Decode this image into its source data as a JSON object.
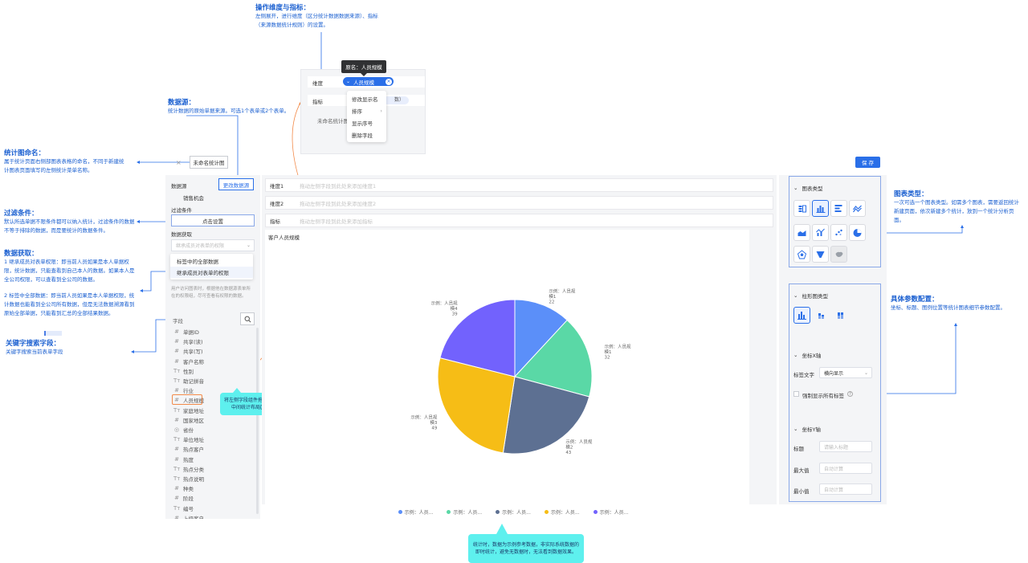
{
  "annotations": {
    "dimension_metric": {
      "title": "操作维度与指标：",
      "body": [
        "左侧展开，进行维度（区分统计数据数据来源）、指标",
        "（来源数据统计规则）的设置。"
      ]
    },
    "datasource": {
      "title": "数据源：",
      "body": [
        "统计数据的原始单据来源。可选1个表单或2个表单。"
      ]
    },
    "chart_name": {
      "title": "统计图命名：",
      "body": [
        "属于统计页面右侧部图表表格的命名，不同于新建统",
        "计图表页面填写的左侧统计菜单名称。"
      ]
    },
    "filter": {
      "title": "过滤条件：",
      "body": [
        "默认所选单据不限条件都可以纳入统计，过滤条件的数据",
        "不等于排除的数据，而是要统计的数据条件。"
      ]
    },
    "data_fetch": {
      "title": "数据获取：",
      "body": [
        "1 继承成员对表单权限：即当前人员如果是本人单据权",
        "限，统计数据，只能查看到自己本人的数据。如果本人是",
        "全公司权限，可以查看到全公司的数据。",
        "",
        "2 标签中全部数据：即当前人员如果是本人单据权限，统",
        "计数据也能看到全公司所有数据，但是无法数据溯源看到",
        "原始全部单据，只能看到汇总的全部结果数据。"
      ]
    },
    "keyword_search": {
      "title": "关键字搜索字段：",
      "body": [
        "关键字搜索当前表单字段"
      ]
    },
    "chart_type": {
      "title": "图表类型：",
      "body": [
        "一次可选一个图表类型。如需多个图表，需要返回统计",
        "新建页面，依次新建多个统计，放到一个统计分析页",
        "面。"
      ]
    },
    "params": {
      "title": "具体参数配置：",
      "body": [
        "坐标、标题、图例位置等统计图表细节参数配置。"
      ]
    },
    "drag_tip": [
      "将左侧字段组件拖拽到",
      "中间统计布局区"
    ],
    "sample_tip": [
      "统计时，数据为示例参考数据，非实际系统数据的",
      "即时统计，避免无数据时，无法看到数据效果。"
    ]
  },
  "popup": {
    "tooltip": "原名：人员规模",
    "dim_label": "维度",
    "metric_label": "指标",
    "chip": "人员规模",
    "metric_chip": "数）",
    "unnamed": "未命名统计图",
    "menu": [
      "修改显示名",
      "排序",
      "显示序号",
      "删除字段"
    ]
  },
  "header": {
    "chart_name": "未命名统计图",
    "save": "保 存"
  },
  "left": {
    "datasource_label": "数据源",
    "change_datasource": "更改数据源",
    "datasource_value": "销售机会",
    "filter_label": "过滤条件",
    "filter_button": "点击设置",
    "fetch_label": "数据获取",
    "fetch_placeholder": "继承成员对表单的权限",
    "fetch_options": [
      "标签中的全部数据",
      "继承成员对表单的权限"
    ],
    "fetch_help": [
      "用户访问图表时，根据他在数据源表单所",
      "在的权限组，尽可查看有权限的数据。"
    ],
    "fields_label": "字段",
    "fields": [
      {
        "icon": "#",
        "name": "单据ID"
      },
      {
        "icon": "#",
        "name": "共享(读)"
      },
      {
        "icon": "#",
        "name": "共享(写)"
      },
      {
        "icon": "#",
        "name": "客户名称"
      },
      {
        "icon": "Tт",
        "name": "性别"
      },
      {
        "icon": "Tт",
        "name": "助记拼音"
      },
      {
        "icon": "#",
        "name": "行业"
      },
      {
        "icon": "#",
        "name": "人员规模"
      },
      {
        "icon": "Tт",
        "name": "家庭地址"
      },
      {
        "icon": "#",
        "name": "国家地区"
      },
      {
        "icon": "◎",
        "name": "省份"
      },
      {
        "icon": "Tт",
        "name": "单位地址"
      },
      {
        "icon": "#",
        "name": "热点客户"
      },
      {
        "icon": "#",
        "name": "热度"
      },
      {
        "icon": "Tт",
        "name": "热点分类"
      },
      {
        "icon": "Tт",
        "name": "热点说明"
      },
      {
        "icon": "#",
        "name": "种类"
      },
      {
        "icon": "#",
        "name": "阶段"
      },
      {
        "icon": "Tт",
        "name": "编号"
      },
      {
        "icon": "#",
        "name": "上级客户"
      }
    ]
  },
  "center": {
    "rows": [
      {
        "label": "维度1",
        "placeholder": "拖动左侧字段到此处来添加维度1"
      },
      {
        "label": "维度2",
        "placeholder": "拖动左侧字段到此处来添加维度2"
      },
      {
        "label": "指标",
        "placeholder": "拖动左侧字段到此处来添加指标"
      }
    ],
    "chart_title": "客户人员规模"
  },
  "chart_data": {
    "type": "pie",
    "title": "客户人员规模",
    "slices": [
      {
        "label": [
          "示例：人员规",
          "模1"
        ],
        "value": 22,
        "color": "#5b8ff9"
      },
      {
        "label": [
          "示例：人员规",
          "模1"
        ],
        "value": 32,
        "color": "#5ad8a6"
      },
      {
        "label": [
          "示例：人员规",
          "模2"
        ],
        "value": 43,
        "color": "#5d7092"
      },
      {
        "label": [
          "示例：人员规",
          "模3"
        ],
        "value": 49,
        "color": "#f6bd16"
      },
      {
        "label": [
          "示例：人员规",
          "模4"
        ],
        "value": 39,
        "color": "#7262fd"
      }
    ],
    "legend": [
      "示例：人员...",
      "示例：人员...",
      "示例：人员...",
      "示例：人员...",
      "示例：人员..."
    ],
    "legend_position": "bottom"
  },
  "right": {
    "chart_type_head": "图表类型",
    "chart_types": [
      "horizontal-bar-table",
      "column",
      "bar",
      "line",
      "area",
      "combo",
      "scatter",
      "pie",
      "radar",
      "funnel",
      "map"
    ],
    "bar_type_head": "柱形图类型",
    "bar_types": [
      "grouped-column",
      "stacked-column",
      "percent-column"
    ],
    "x_axis_head": "坐标X轴",
    "label_text": "标签文字",
    "label_value": "横向显示",
    "force_labels": "强制显示所有标签",
    "y_axis_head": "坐标Y轴",
    "title_label": "标题",
    "title_placeholder": "请输入标题",
    "max_label": "最大值",
    "max_placeholder": "自动计算",
    "min_label": "最小值",
    "min_placeholder": "自动计算"
  },
  "colors": {
    "accent": "#2a6fe8",
    "annotation": "#1a5fd0",
    "callout": "#5ef0ee",
    "drag_line": "#f28a4a"
  }
}
